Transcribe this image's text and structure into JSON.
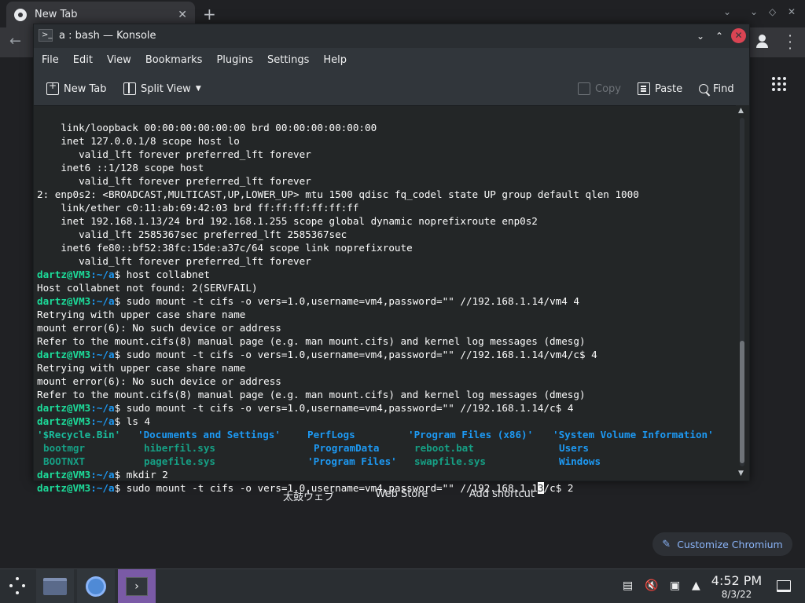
{
  "chrome": {
    "tab_title": "New Tab",
    "tab_close": "✕",
    "new_tab": "+",
    "shortcuts": [
      "太鼓ウェブ",
      "Web Store",
      "Add shortcut"
    ],
    "customize_label": "Customize Chromium"
  },
  "konsole": {
    "title": "a : bash — Konsole",
    "menu": [
      "File",
      "Edit",
      "View",
      "Bookmarks",
      "Plugins",
      "Settings",
      "Help"
    ],
    "toolbar": {
      "new_tab": "New Tab",
      "split_view": "Split View",
      "copy": "Copy",
      "paste": "Paste",
      "find": "Find"
    },
    "prompt_user": "dartz@VM3",
    "prompt_path": ":~/a",
    "prompt_sym": "$ ",
    "lines": [
      "    link/loopback 00:00:00:00:00:00 brd 00:00:00:00:00:00",
      "    inet 127.0.0.1/8 scope host lo",
      "       valid_lft forever preferred_lft forever",
      "    inet6 ::1/128 scope host",
      "       valid_lft forever preferred_lft forever",
      "2: enp0s2: <BROADCAST,MULTICAST,UP,LOWER_UP> mtu 1500 qdisc fq_codel state UP group default qlen 1000",
      "    link/ether c0:11:ab:69:42:03 brd ff:ff:ff:ff:ff:ff",
      "    inet 192.168.1.13/24 brd 192.168.1.255 scope global dynamic noprefixroute enp0s2",
      "       valid_lft 2585367sec preferred_lft 2585367sec",
      "    inet6 fe80::bf52:38fc:15de:a37c/64 scope link noprefixroute",
      "       valid_lft forever preferred_lft forever"
    ],
    "cmd1": "host collabnet",
    "out1": [
      "Host collabnet not found: 2(SERVFAIL)"
    ],
    "cmd2": "sudo mount -t cifs -o vers=1.0,username=vm4,password=\"\" //192.168.1.14/vm4 4",
    "out2": [
      "Retrying with upper case share name",
      "mount error(6): No such device or address",
      "Refer to the mount.cifs(8) manual page (e.g. man mount.cifs) and kernel log messages (dmesg)"
    ],
    "cmd3": "sudo mount -t cifs -o vers=1.0,username=vm4,password=\"\" //192.168.1.14/vm4/c$ 4",
    "out3": [
      "Retrying with upper case share name",
      "mount error(6): No such device or address",
      "Refer to the mount.cifs(8) manual page (e.g. man mount.cifs) and kernel log messages (dmesg)"
    ],
    "cmd4": "sudo mount -t cifs -o vers=1.0,username=vm4,password=\"\" //192.168.1.14/c$ 4",
    "cmd5": "ls 4",
    "ls": {
      "r1": [
        "'$Recycle.Bin'",
        "'Documents and Settings'",
        "PerfLogs",
        "'Program Files (x86)'",
        "'System Volume Information'"
      ],
      "r2": [
        "bootmgr",
        "hiberfil.sys",
        "ProgramData",
        "reboot.bat",
        "Users"
      ],
      "r3": [
        "BOOTNXT",
        "pagefile.sys",
        "'Program Files'",
        "swapfile.sys",
        "Windows"
      ]
    },
    "cmd6": "mkdir 2",
    "cmd7_a": "sudo mount -t cifs -o vers=1.0,username=vm4,password=\"\" //192.168.1.1",
    "cmd7_cursor": "3",
    "cmd7_b": "/c$ 2"
  },
  "taskbar": {
    "time": "4:52 PM",
    "date": "8/3/22"
  }
}
